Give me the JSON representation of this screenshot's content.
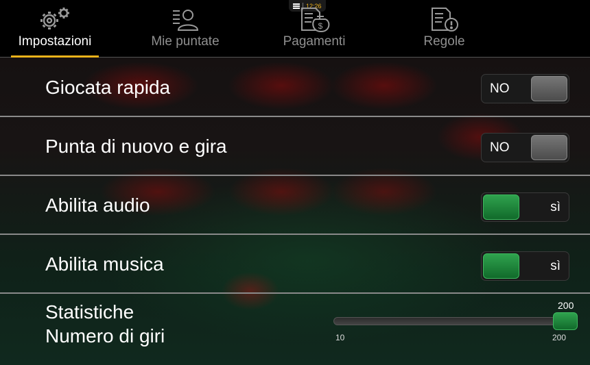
{
  "status": {
    "time": "12:26"
  },
  "tabs": [
    {
      "label": "Impostazioni",
      "icon": "gears-icon",
      "active": true
    },
    {
      "label": "Mie puntate",
      "icon": "user-list-icon",
      "active": false
    },
    {
      "label": "Pagamenti",
      "icon": "money-document-icon",
      "active": false
    },
    {
      "label": "Regole",
      "icon": "rules-document-icon",
      "active": false
    }
  ],
  "settings": [
    {
      "label": "Giocata rapida",
      "state": "NO",
      "on": false
    },
    {
      "label": "Punta di nuovo e gira",
      "state": "NO",
      "on": false
    },
    {
      "label": "Abilita audio",
      "state": "sì",
      "on": true
    },
    {
      "label": "Abilita musica",
      "state": "sì",
      "on": true
    }
  ],
  "stats": {
    "title": "Statistiche",
    "subtitle": "Numero di giri",
    "value": "200",
    "min": "10",
    "max": "200"
  },
  "colors": {
    "accent": "#f0b31a",
    "on": "#1f8a3c",
    "off": "#5e5e5e"
  }
}
